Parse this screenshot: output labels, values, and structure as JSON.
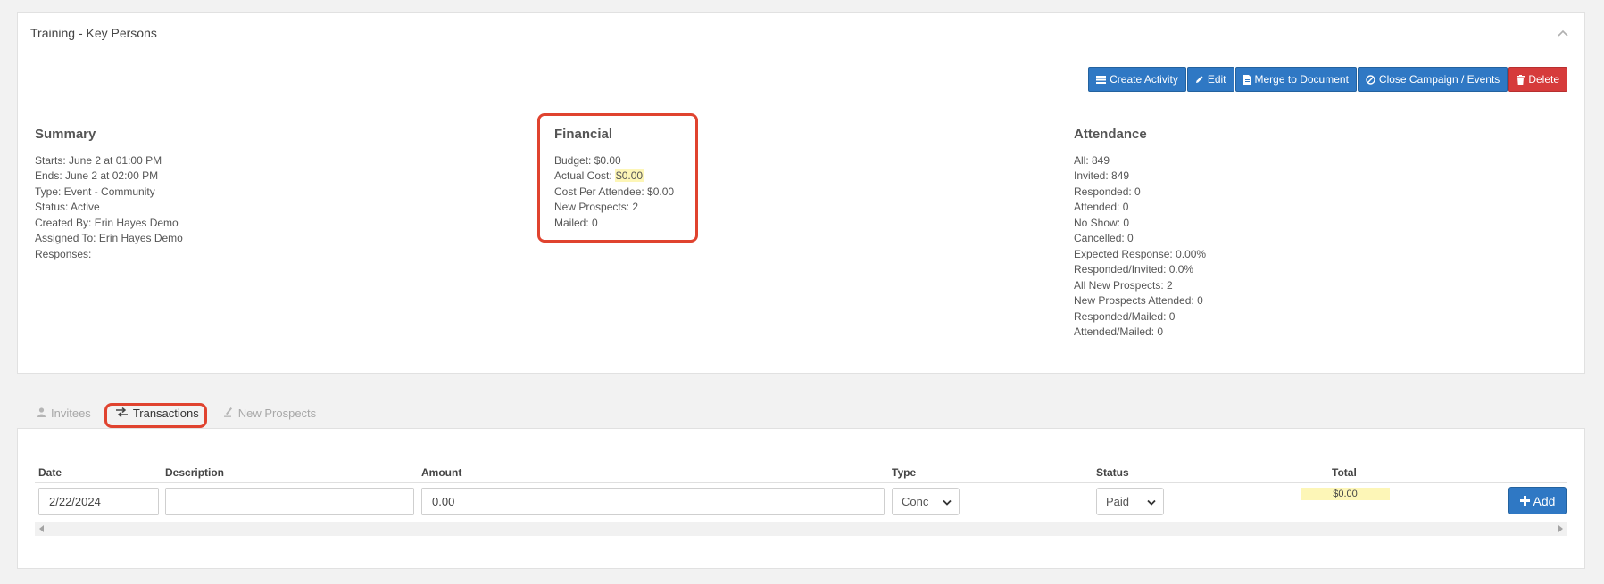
{
  "panel": {
    "title": "Training - Key Persons"
  },
  "toolbar": {
    "create_activity": "Create Activity",
    "edit": "Edit",
    "merge": "Merge to Document",
    "close": "Close Campaign / Events",
    "delete": "Delete"
  },
  "summary": {
    "heading": "Summary",
    "lines": [
      "Starts: June 2 at 01:00 PM",
      "Ends: June 2 at 02:00 PM",
      "Type: Event - Community",
      "Status: Active",
      "Created By: Erin Hayes Demo",
      "Assigned To: Erin Hayes Demo",
      "Responses:"
    ]
  },
  "financial": {
    "heading": "Financial",
    "budget": "Budget: $0.00",
    "actual_cost_label": "Actual Cost: ",
    "actual_cost_value": "$0.00",
    "cost_per_attendee": "Cost Per Attendee: $0.00",
    "new_prospects": "New Prospects: 2",
    "mailed": "Mailed: 0"
  },
  "attendance": {
    "heading": "Attendance",
    "lines": [
      "All: 849",
      "Invited: 849",
      "Responded: 0",
      "Attended: 0",
      "No Show: 0",
      "Cancelled: 0",
      "Expected Response: 0.00%",
      "Responded/Invited: 0.0%",
      "All New Prospects: 2",
      "New Prospects Attended: 0",
      "Responded/Mailed: 0",
      "Attended/Mailed: 0"
    ]
  },
  "tabs": {
    "invitees": "Invitees",
    "transactions": "Transactions",
    "new_prospects": "New Prospects"
  },
  "table": {
    "headers": [
      "Date",
      "Description",
      "Amount",
      "Type",
      "Status",
      "Total"
    ],
    "date_value": "2/22/2024",
    "description_value": "",
    "amount_value": "0.00",
    "type_value": "Conc",
    "status_value": "Paid",
    "total_value": "$0.00",
    "add_label": "Add"
  },
  "colors": {
    "primary": "#2f78c4",
    "danger": "#d63b3b",
    "highlight": "#fdf6b7",
    "annotation": "#e0432f"
  }
}
